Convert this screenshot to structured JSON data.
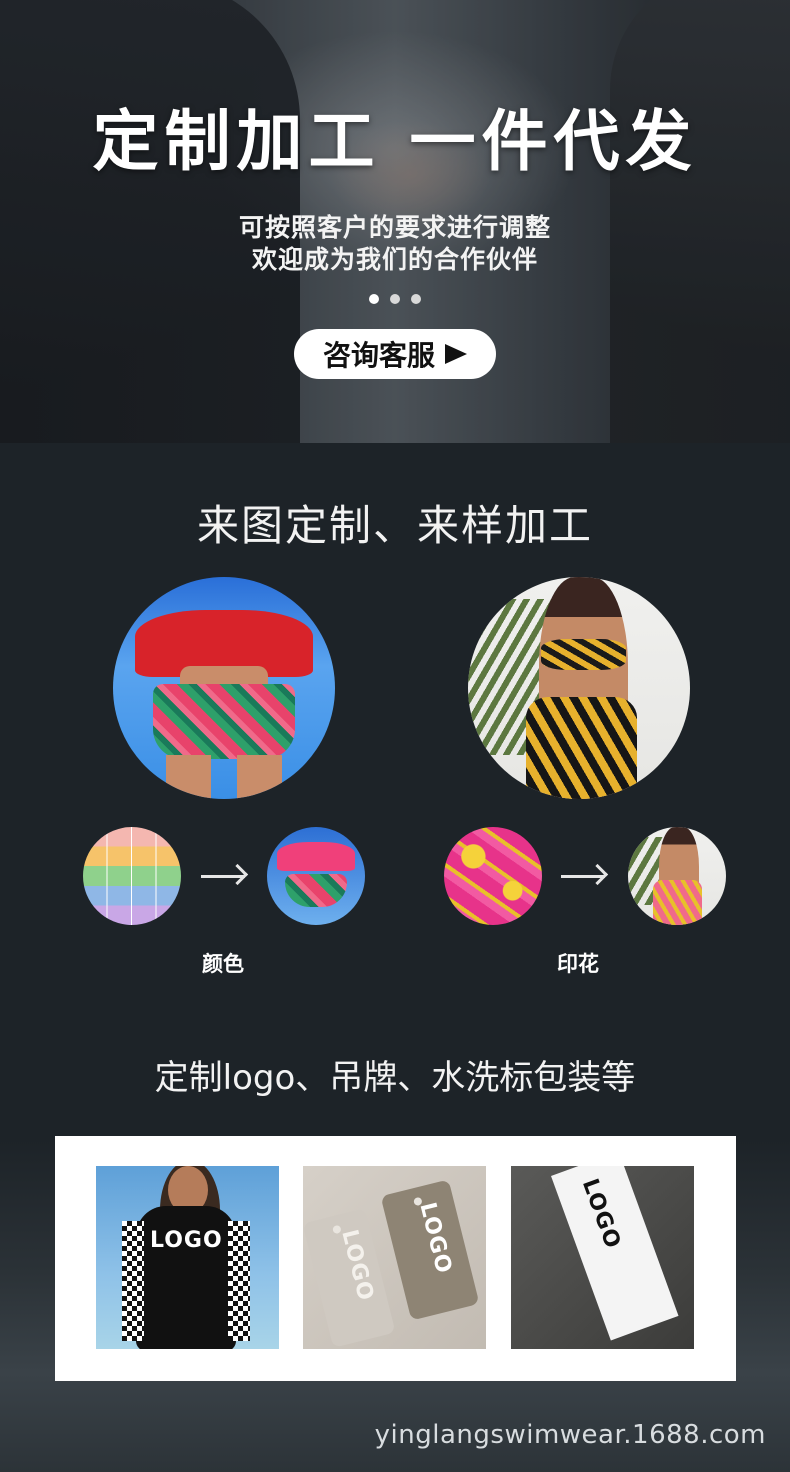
{
  "hero": {
    "title": "定制加工 一件代发",
    "subtitle_line1": "可按照客户的要求进行调整",
    "subtitle_line2": "欢迎成为我们的合作伙伴",
    "cta_label": "咨询客服",
    "carousel_dots": 3,
    "carousel_active": 1
  },
  "section1": {
    "title": "来图定制、来样加工",
    "items": [
      {
        "caption": "颜色"
      },
      {
        "caption": "印花"
      }
    ]
  },
  "section2": {
    "title": "定制logo、吊牌、水洗标包装等",
    "tiles": [
      {
        "logo_text": "LOGO"
      },
      {
        "logo_text": "LOGO"
      },
      {
        "logo_text": "LOGO"
      }
    ]
  },
  "footer": {
    "url": "yinglangswimwear.1688.com"
  },
  "colors": {
    "background": "#1d2328",
    "cta_bg": "#ffffff",
    "text": "#ffffff"
  }
}
